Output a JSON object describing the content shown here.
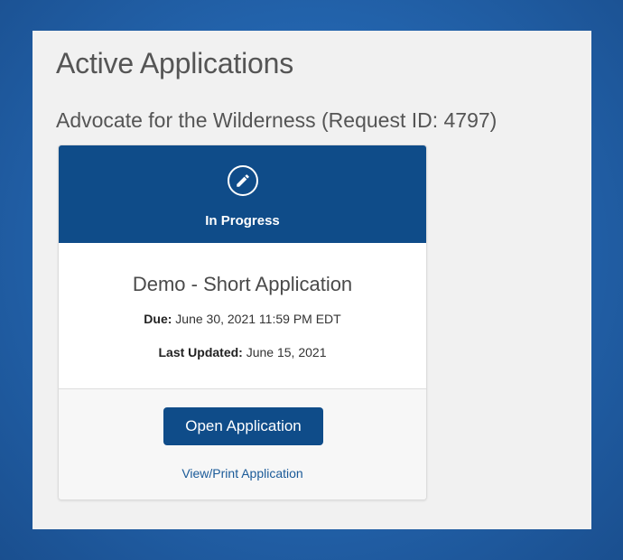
{
  "page": {
    "title": "Active Applications"
  },
  "request": {
    "heading": "Advocate for the Wilderness (Request ID: 4797)"
  },
  "card": {
    "status": {
      "label": "In Progress",
      "icon": "pencil-icon"
    },
    "application_name": "Demo - Short Application",
    "due_label": "Due:",
    "due_value": " June 30, 2021 11:59 PM EDT",
    "updated_label": "Last Updated:",
    "updated_value": " June 15, 2021",
    "open_button_label": "Open Application",
    "print_link_label": "View/Print Application"
  },
  "colors": {
    "brand": "#0f4c89",
    "link": "#1a5a98",
    "panel_background": "#f1f1f1",
    "page_background": "#2466b0"
  }
}
